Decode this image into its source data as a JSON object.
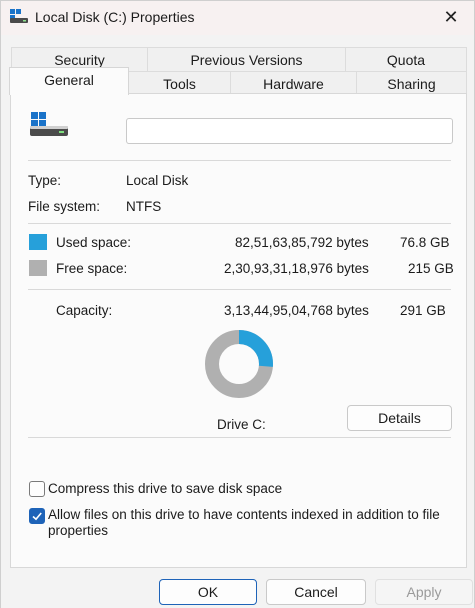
{
  "window": {
    "title": "Local Disk (C:) Properties",
    "close_icon": "close-icon",
    "title_icon": "drive-icon"
  },
  "tabs": {
    "back_row": [
      {
        "label": "Security"
      },
      {
        "label": "Previous Versions"
      },
      {
        "label": "Quota"
      }
    ],
    "front_row": [
      {
        "label": "General",
        "active": true
      },
      {
        "label": "Tools"
      },
      {
        "label": "Hardware"
      },
      {
        "label": "Sharing"
      }
    ]
  },
  "general": {
    "drive_name_value": "",
    "type_label": "Type:",
    "type_value": "Local Disk",
    "fs_label": "File system:",
    "fs_value": "NTFS",
    "used_label": "Used space:",
    "used_bytes": "82,51,63,85,792 bytes",
    "used_gb": "76.8 GB",
    "free_label": "Free space:",
    "free_bytes": "2,30,93,31,18,976 bytes",
    "free_gb": "215 GB",
    "capacity_label": "Capacity:",
    "capacity_bytes": "3,13,44,95,04,768 bytes",
    "capacity_gb": "291 GB",
    "drive_label": "Drive C:",
    "details_button": "Details",
    "used_fraction": 0.2633,
    "used_color": "#26a0da",
    "free_color": "#b0b0b0",
    "compress_label": "Compress this drive to save disk space",
    "compress_checked": false,
    "index_label_line1": "Allow files on this drive to have contents indexed in addition to file",
    "index_label_line2": "properties",
    "index_checked": true
  },
  "footer": {
    "ok": "OK",
    "cancel": "Cancel",
    "apply": "Apply"
  }
}
